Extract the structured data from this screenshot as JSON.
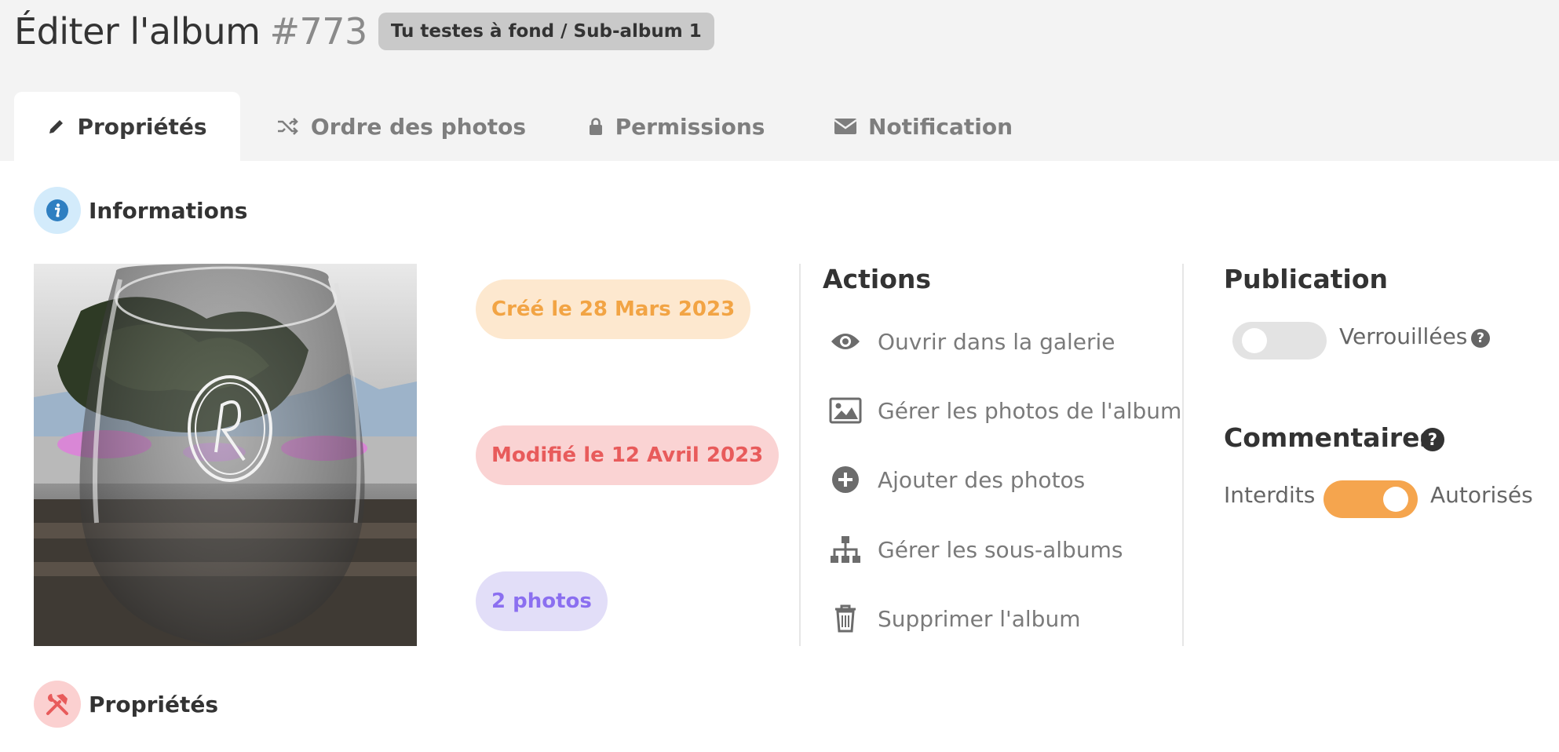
{
  "header": {
    "title": "Éditer l'album",
    "album_id": "#773",
    "path_badge": "Tu testes à fond / Sub-album 1"
  },
  "tabs": [
    {
      "label": "Propriétés",
      "icon": "pencil-icon",
      "active": true
    },
    {
      "label": "Ordre des photos",
      "icon": "shuffle-icon",
      "active": false
    },
    {
      "label": "Permissions",
      "icon": "lock-icon",
      "active": false
    },
    {
      "label": "Notification",
      "icon": "envelope-icon",
      "active": false
    }
  ],
  "sections": {
    "informations": {
      "title": "Informations",
      "icon": "info-icon",
      "color": "#2f7fc1"
    },
    "proprietes": {
      "title": "Propriétés",
      "icon": "hammer-wrench-icon",
      "color": "#e85b5b"
    }
  },
  "info": {
    "created": "Créé le 28 Mars 2023",
    "modified": "Modifié le 12 Avril 2023",
    "photo_count": "2 photos"
  },
  "actions": {
    "title": "Actions",
    "items": [
      {
        "label": "Ouvrir dans la galerie",
        "icon": "eye-icon"
      },
      {
        "label": "Gérer les photos de l'album",
        "icon": "image-icon"
      },
      {
        "label": "Ajouter des photos",
        "icon": "plus-circle-icon"
      },
      {
        "label": "Gérer les sous-albums",
        "icon": "sitemap-icon"
      },
      {
        "label": "Supprimer l'album",
        "icon": "trash-icon"
      }
    ]
  },
  "publication": {
    "title": "Publication",
    "locked_label": "Verrouillées",
    "locked": false
  },
  "comments": {
    "title": "Commentaires",
    "off_label": "Interdits",
    "on_label": "Autorisés",
    "allowed": true
  },
  "colors": {
    "accent_orange": "#f5a54e",
    "created_text": "#f2a444",
    "modified_text": "#e85b5b",
    "count_text": "#8b6ff0"
  }
}
